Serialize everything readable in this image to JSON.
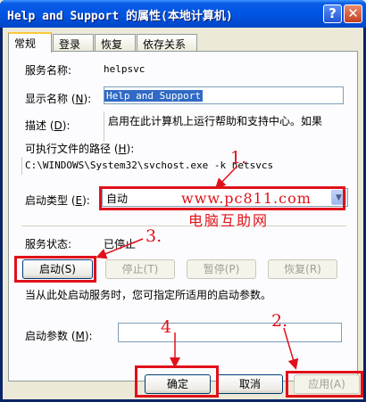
{
  "window": {
    "title": "Help and Support 的属性(本地计算机)"
  },
  "titlebar_buttons": {
    "help": "?",
    "close": "✕"
  },
  "tabs": [
    {
      "label": "常规"
    },
    {
      "label": "登录"
    },
    {
      "label": "恢复"
    },
    {
      "label": "依存关系"
    }
  ],
  "general": {
    "service_name_label": "服务名称:",
    "service_name_value": "helpsvc",
    "display_name_label": "显示名称",
    "display_name_key": "N",
    "display_name_value": "Help and Support",
    "description_label": "描述",
    "description_key": "D",
    "description_value": "启用在此计算机上运行帮助和支持中心。如果",
    "path_label": "可执行文件的路径",
    "path_key": "H",
    "path_value": "C:\\WINDOWS\\System32\\svchost.exe -k netsvcs",
    "startup_type_label": "启动类型",
    "startup_type_key": "E",
    "startup_type_value": "自动",
    "status_label": "服务状态:",
    "status_value": "已停止",
    "start_button": "启动(S)",
    "stop_button": "停止(T)",
    "pause_button": "暂停(P)",
    "resume_button": "恢复(R)",
    "hint_text": "当从此处启动服务时，您可指定所适用的启动参数。",
    "params_label": "启动参数",
    "params_key": "M",
    "params_value": ""
  },
  "footer": {
    "ok_button": "确定",
    "cancel_button": "取消",
    "apply_button": "应用(A)"
  },
  "annotations": {
    "marker_1": "1.",
    "marker_2": "2.",
    "marker_3": "3.",
    "marker_4": "4",
    "watermark_url": "www.pc811.com",
    "watermark_text": "电脑互助网"
  },
  "colors": {
    "annotation_red": "#e0111a",
    "title_blue": "#0054e3",
    "dialog_bg": "#ece9d8"
  }
}
